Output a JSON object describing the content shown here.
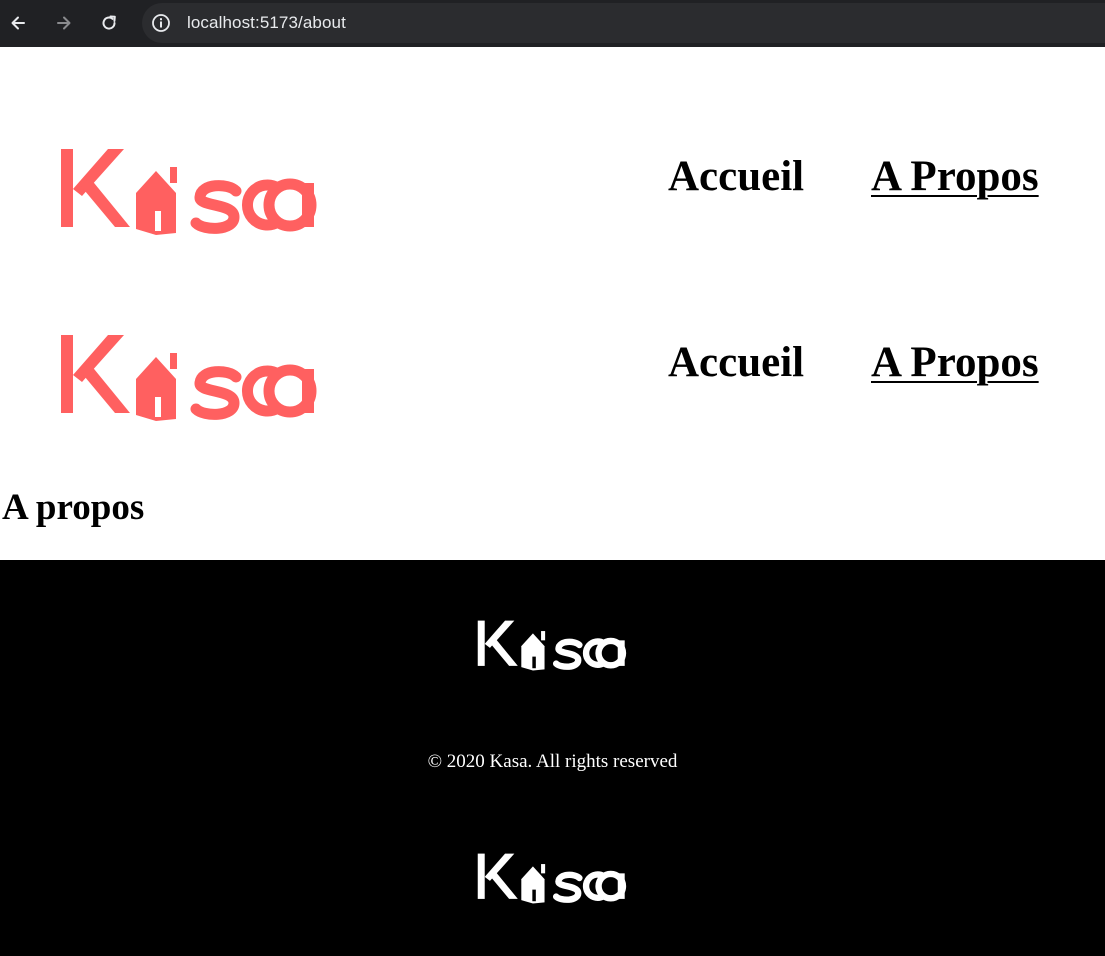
{
  "browser": {
    "back_icon": "arrow-left-icon",
    "forward_icon": "arrow-right-icon",
    "reload_icon": "reload-icon",
    "info_icon": "info-icon",
    "url": "localhost:5173/about"
  },
  "brand": {
    "name": "Kasa",
    "accent_color": "#ff6060",
    "footer_logo_color": "#ffffff"
  },
  "headers": [
    {
      "nav": {
        "home_label": "Accueil",
        "about_label": "A Propos",
        "active": "about"
      }
    },
    {
      "nav": {
        "home_label": "Accueil",
        "about_label": "A Propos",
        "active": "about"
      }
    }
  ],
  "main": {
    "title": "A propos"
  },
  "footer": {
    "copyright": "© 2020 Kasa. All rights reserved",
    "background": "#000000"
  }
}
